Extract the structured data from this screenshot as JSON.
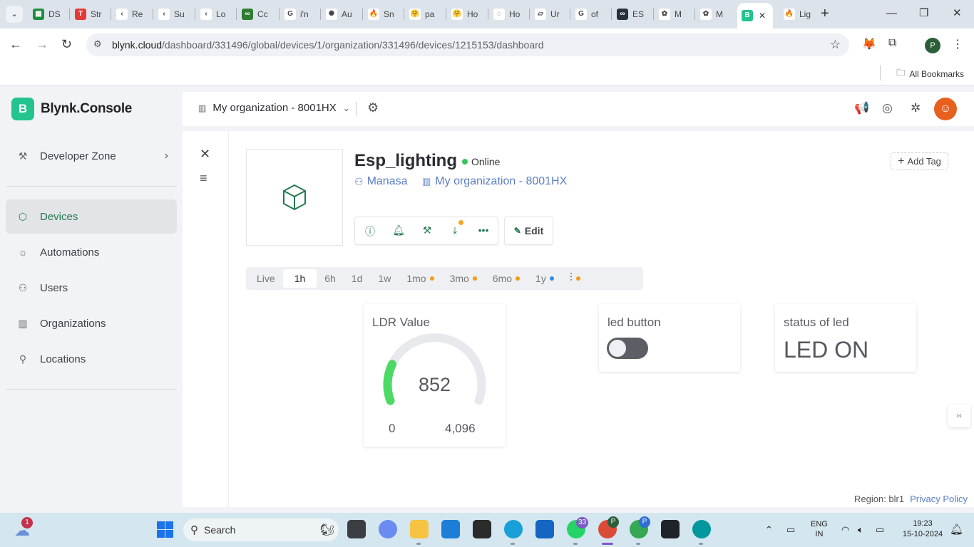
{
  "browser": {
    "tabs": [
      {
        "short": "DS",
        "color": "#1e8e3e",
        "glyph": "▦"
      },
      {
        "short": "Str",
        "color": "#e53935",
        "glyph": "T"
      },
      {
        "short": "Re",
        "color": "#ffffff",
        "glyph": "‹"
      },
      {
        "short": "Su",
        "color": "#ffffff",
        "glyph": "‹"
      },
      {
        "short": "Lo",
        "color": "#ffffff",
        "glyph": "‹"
      },
      {
        "short": "Cc",
        "color": "#2e7d32",
        "glyph": "∞"
      },
      {
        "short": "i'n",
        "color": "#ffffff",
        "glyph": "G"
      },
      {
        "short": "Au",
        "color": "#ffffff",
        "glyph": "✺"
      },
      {
        "short": "Sn",
        "color": "#ffffff",
        "glyph": "🔥"
      },
      {
        "short": "pa",
        "color": "#ffffff",
        "glyph": "🤗"
      },
      {
        "short": "Ho",
        "color": "#ffffff",
        "glyph": "🤗"
      },
      {
        "short": "Ho",
        "color": "#ffffff",
        "glyph": "◌"
      },
      {
        "short": "Ur",
        "color": "#ffffff",
        "glyph": "▱"
      },
      {
        "short": "of",
        "color": "#ffffff",
        "glyph": "G"
      },
      {
        "short": "ES",
        "color": "#263238",
        "glyph": "∞"
      },
      {
        "short": "M",
        "color": "#ffffff",
        "glyph": "✿"
      },
      {
        "short": "M",
        "color": "#ffffff",
        "glyph": "✿"
      },
      {
        "short": "",
        "color": "#23c48e",
        "glyph": "B"
      },
      {
        "short": "Lig",
        "color": "#ffffff",
        "glyph": "🔥"
      }
    ],
    "active_tab_close": "✕",
    "new_tab": "+",
    "url_domain": "blynk.cloud",
    "url_path": "/dashboard/331496/global/devices/1/organization/331496/devices/1215153/dashboard",
    "profile_initial": "P",
    "bookmarks_label": "All Bookmarks"
  },
  "app": {
    "brand_letter": "B",
    "brand_name": "Blynk.Console",
    "org_name": "My organization - 8001HX",
    "nav": {
      "developer_zone": "Developer Zone",
      "devices": "Devices",
      "automations": "Automations",
      "users": "Users",
      "organizations": "Organizations",
      "locations": "Locations"
    }
  },
  "device": {
    "title": "Esp_lighting",
    "status": "Online",
    "owner": "Manasa",
    "organization": "My organization - 8001HX",
    "add_tag": "Add Tag",
    "edit_label": "Edit"
  },
  "time_ranges": [
    {
      "label": "Live",
      "dot": null
    },
    {
      "label": "1h",
      "dot": null,
      "selected": true
    },
    {
      "label": "6h",
      "dot": null
    },
    {
      "label": "1d",
      "dot": null
    },
    {
      "label": "1w",
      "dot": null
    },
    {
      "label": "1mo",
      "dot": "#f39c12"
    },
    {
      "label": "3mo",
      "dot": "#f39c12"
    },
    {
      "label": "6mo",
      "dot": "#f39c12"
    },
    {
      "label": "1y",
      "dot": "#2f8be6"
    }
  ],
  "custom_range_dot": "#f39c12",
  "widgets": {
    "ldr": {
      "title": "LDR Value",
      "value": 852,
      "value_text": "852",
      "min": "0",
      "max": "4,096",
      "accent": "#4cd964"
    },
    "led_button": {
      "title": "led button",
      "state": "off"
    },
    "status_led": {
      "title": "status of led",
      "text": "LED ON"
    }
  },
  "footer": {
    "region": "Region: blr1",
    "privacy": "Privacy Policy"
  },
  "taskbar": {
    "weather_badge": "1",
    "search_placeholder": "Search",
    "whatsapp_badge": "33",
    "chrome_badge_1": "P",
    "chrome_badge_2": "P",
    "lang_1": "ENG",
    "lang_2": "IN",
    "time": "19:23",
    "date": "15-10-2024"
  }
}
